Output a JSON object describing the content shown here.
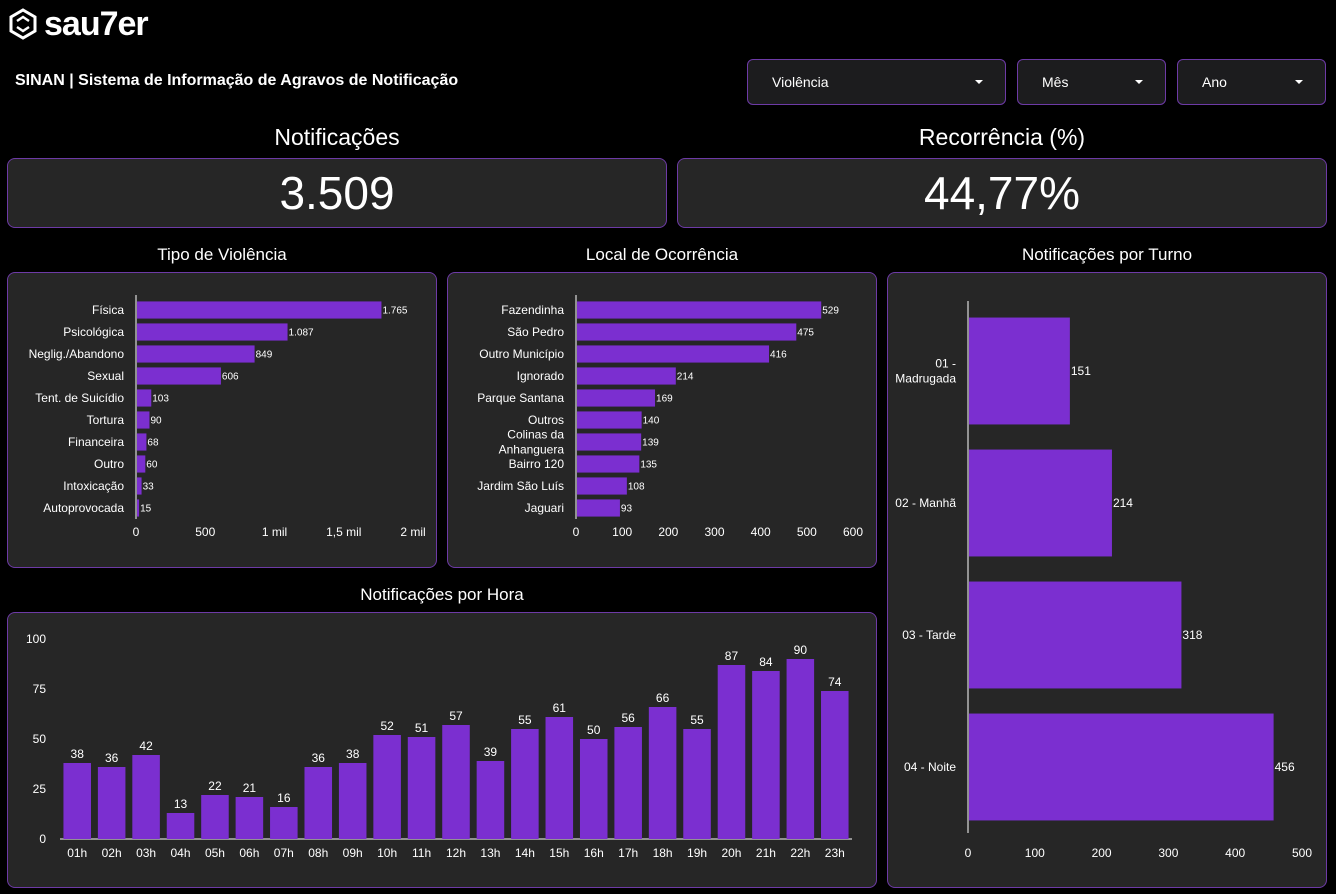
{
  "brand": {
    "logo_text": "sau7er"
  },
  "header": {
    "title": "SINAN | Sistema de Informação de Agravos de Notificação"
  },
  "filters": [
    {
      "label": "Violência"
    },
    {
      "label": "Mês"
    },
    {
      "label": "Ano"
    }
  ],
  "kpis": {
    "notificacoes": {
      "title": "Notificações",
      "value": "3.509"
    },
    "recorrencia": {
      "title": "Recorrência (%)",
      "value": "44,77%"
    }
  },
  "colors": {
    "bar": "#7b2fd0",
    "panel": "#262626",
    "border": "#6d3aa6"
  },
  "chart_data": [
    {
      "id": "tipo",
      "type": "bar",
      "orientation": "horizontal",
      "title": "Tipo de Violência",
      "categories": [
        "Física",
        "Psicológica",
        "Neglig./Abandono",
        "Sexual",
        "Tent. de Suicídio",
        "Tortura",
        "Financeira",
        "Outro",
        "Intoxicação",
        "Autoprovocada"
      ],
      "values": [
        1765,
        1087,
        849,
        606,
        103,
        90,
        68,
        60,
        33,
        15
      ],
      "value_labels": [
        "1.765",
        "1.087",
        "849",
        "606",
        "103",
        "90",
        "68",
        "60",
        "33",
        "15"
      ],
      "xlim": [
        0,
        2000
      ],
      "ticks": [
        0,
        500,
        1000,
        1500,
        2000
      ],
      "tick_labels": [
        "0",
        "500",
        "1 mil",
        "1,5 mil",
        "2 mil"
      ]
    },
    {
      "id": "local",
      "type": "bar",
      "orientation": "horizontal",
      "title": "Local de Ocorrência",
      "categories": [
        "Fazendinha",
        "São Pedro",
        "Outro Município",
        "Ignorado",
        "Parque Santana",
        "Outros",
        "Colinas da Anhanguera",
        "Bairro 120",
        "Jardim São Luís",
        "Jaguari"
      ],
      "values": [
        529,
        475,
        416,
        214,
        169,
        140,
        139,
        135,
        108,
        93
      ],
      "value_labels": [
        "529",
        "475",
        "416",
        "214",
        "169",
        "140",
        "139",
        "135",
        "108",
        "93"
      ],
      "xlim": [
        0,
        600
      ],
      "ticks": [
        0,
        100,
        200,
        300,
        400,
        500,
        600
      ],
      "tick_labels": [
        "0",
        "100",
        "200",
        "300",
        "400",
        "500",
        "600"
      ]
    },
    {
      "id": "turno",
      "type": "bar",
      "orientation": "horizontal",
      "title": "Notificações por Turno",
      "categories": [
        "01 - Madrugada",
        "02 - Manhã",
        "03 - Tarde",
        "04 - Noite"
      ],
      "values": [
        151,
        214,
        318,
        456
      ],
      "value_labels": [
        "151",
        "214",
        "318",
        "456"
      ],
      "xlim": [
        0,
        500
      ],
      "ticks": [
        0,
        100,
        200,
        300,
        400,
        500
      ],
      "tick_labels": [
        "0",
        "100",
        "200",
        "300",
        "400",
        "500"
      ]
    },
    {
      "id": "hora",
      "type": "bar",
      "orientation": "vertical",
      "title": "Notificações por Hora",
      "categories": [
        "01h",
        "02h",
        "03h",
        "04h",
        "05h",
        "06h",
        "07h",
        "08h",
        "09h",
        "10h",
        "11h",
        "12h",
        "13h",
        "14h",
        "15h",
        "16h",
        "17h",
        "18h",
        "19h",
        "20h",
        "21h",
        "22h",
        "23h"
      ],
      "values": [
        38,
        36,
        42,
        13,
        22,
        21,
        16,
        36,
        38,
        52,
        51,
        57,
        39,
        55,
        61,
        50,
        56,
        66,
        55,
        87,
        84,
        90,
        74
      ],
      "ylim": [
        0,
        100
      ],
      "ticks": [
        0,
        25,
        50,
        75,
        100
      ],
      "tick_labels": [
        "0",
        "25",
        "50",
        "75",
        "100"
      ]
    }
  ]
}
